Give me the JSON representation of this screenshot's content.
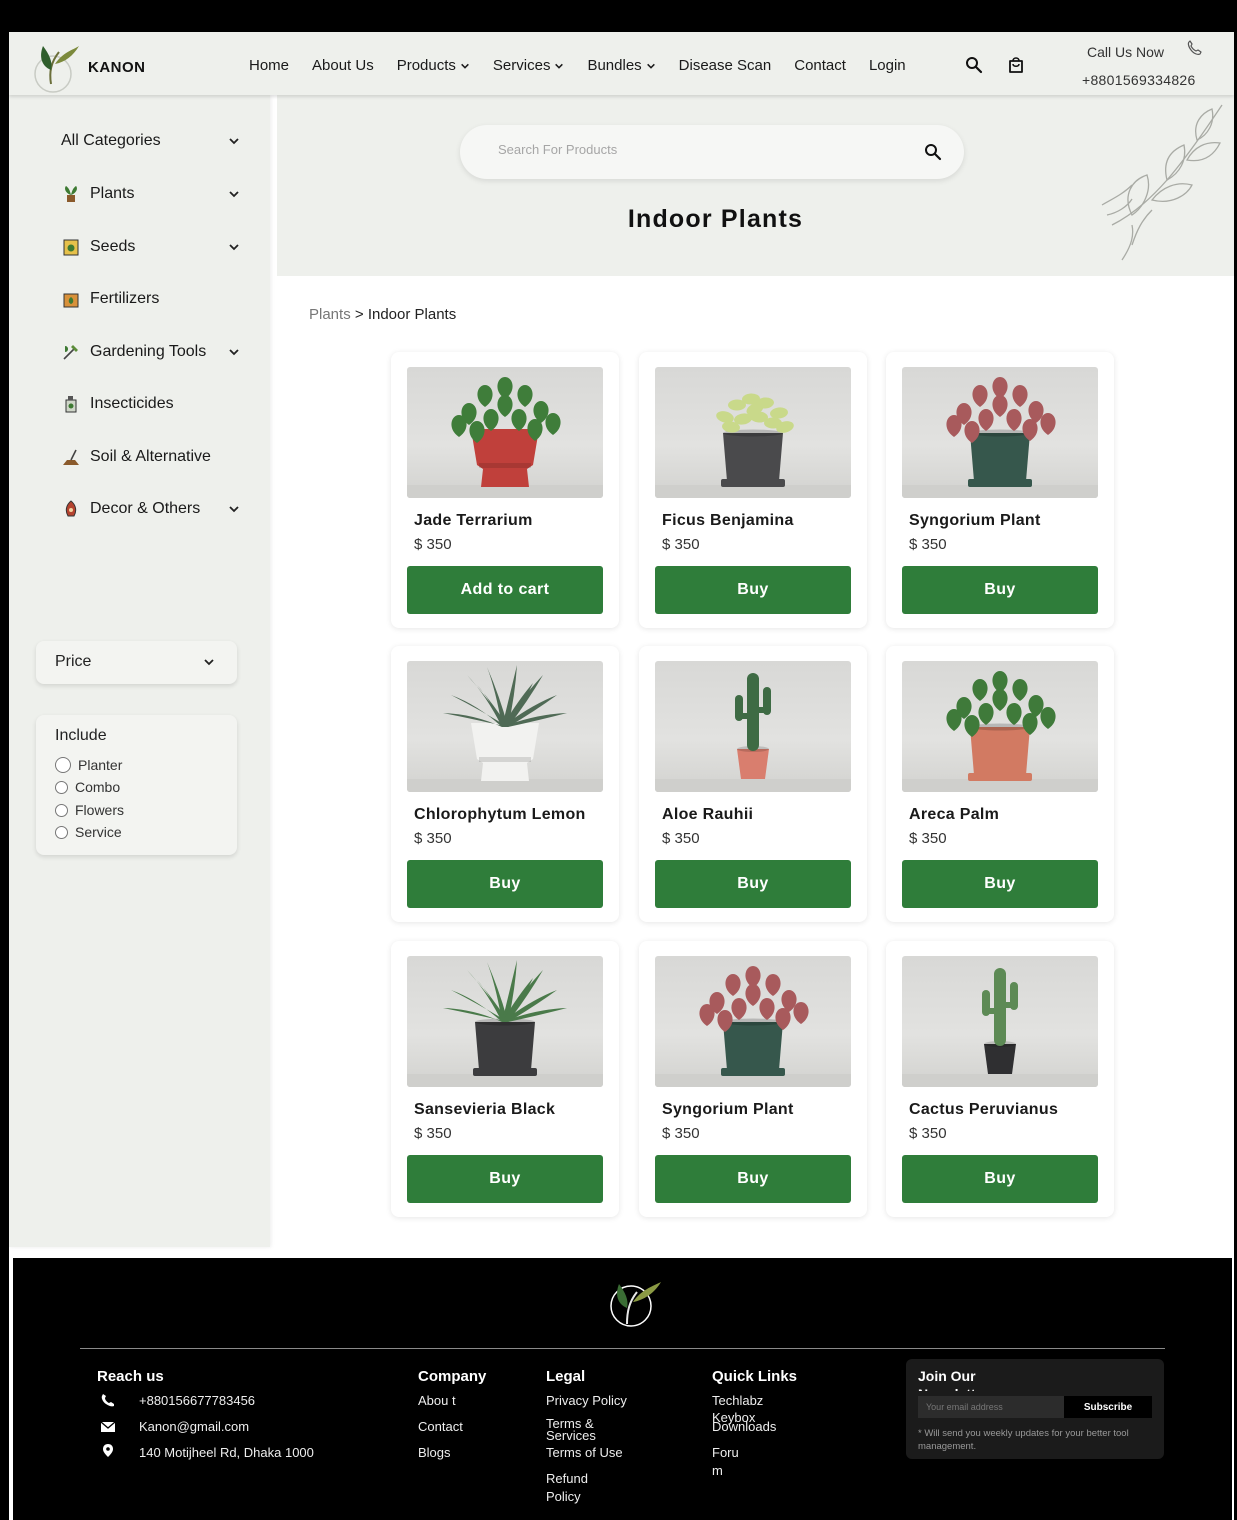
{
  "header": {
    "brand": "KANON",
    "nav": [
      {
        "label": "Home",
        "dropdown": false
      },
      {
        "label": "About Us",
        "dropdown": false
      },
      {
        "label": "Products",
        "dropdown": true
      },
      {
        "label": "Services",
        "dropdown": true
      },
      {
        "label": "Bundles",
        "dropdown": true
      },
      {
        "label": "Disease Scan",
        "dropdown": false
      },
      {
        "label": "Contact",
        "dropdown": false
      },
      {
        "label": "Login",
        "dropdown": false
      }
    ],
    "call_label": "Call Us Now",
    "phone": "+8801569334826"
  },
  "sidebar": {
    "categories": [
      {
        "label": "All Categories",
        "icon": "none",
        "dropdown": true
      },
      {
        "label": "Plants",
        "icon": "plant-icon",
        "dropdown": true
      },
      {
        "label": "Seeds",
        "icon": "seeds-icon",
        "dropdown": true
      },
      {
        "label": "Fertilizers",
        "icon": "fertilizer-icon",
        "dropdown": false
      },
      {
        "label": "Gardening Tools",
        "icon": "gardening-tools-icon",
        "dropdown": true
      },
      {
        "label": "Insecticides",
        "icon": "insecticide-icon",
        "dropdown": false
      },
      {
        "label": "Soil & Alternative",
        "icon": "soil-icon",
        "dropdown": false
      },
      {
        "label": "Decor & Others",
        "icon": "decor-icon",
        "dropdown": true
      }
    ],
    "price_label": "Price",
    "include_title": "Include",
    "include_options": [
      "Planter",
      "Combo",
      "Flowers",
      "Service"
    ]
  },
  "hero": {
    "search_placeholder": "Search For Products",
    "title": "Indoor Plants"
  },
  "breadcrumb": {
    "parent": "Plants",
    "separator": " > ",
    "current": "Indoor Plants"
  },
  "products": [
    {
      "name": "Jade Terrarium",
      "price": "$ 350",
      "button": "Add to cart",
      "pot": "#c0403b",
      "pot_shape": "stepped",
      "foliage": "#3f7d3a",
      "leaf_style": "broad"
    },
    {
      "name": "Ficus Benjamina",
      "price": "$ 350",
      "button": "Buy",
      "pot": "#4a4a4c",
      "pot_shape": "cylinder",
      "foliage": "#c9d98a",
      "leaf_style": "small"
    },
    {
      "name": "Syngorium Plant",
      "price": "$ 350",
      "button": "Buy",
      "pot": "#36574c",
      "pot_shape": "cylinder",
      "foliage": "#a85a5c",
      "leaf_style": "broad"
    },
    {
      "name": "Chlorophytum Lemon",
      "price": "$ 350",
      "button": "Buy",
      "pot": "#f2f2f0",
      "pot_shape": "stepped",
      "foliage": "#4f6a55",
      "leaf_style": "spiky"
    },
    {
      "name": "Aloe Rauhii",
      "price": "$ 350",
      "button": "Buy",
      "pot": "#d97e6e",
      "pot_shape": "small",
      "foliage": "#3e6b44",
      "leaf_style": "cactus"
    },
    {
      "name": "Areca Palm",
      "price": "$ 350",
      "button": "Buy",
      "pot": "#d27a62",
      "pot_shape": "cylinder",
      "foliage": "#3f7a3a",
      "leaf_style": "broad"
    },
    {
      "name": "Sansevieria Black",
      "price": "$ 350",
      "button": "Buy",
      "pot": "#3c3c3e",
      "pot_shape": "cylinder",
      "foliage": "#4a7a4a",
      "leaf_style": "spiky"
    },
    {
      "name": "Syngorium Plant",
      "price": "$ 350",
      "button": "Buy",
      "pot": "#36574c",
      "pot_shape": "cylinder",
      "foliage": "#a85a5c",
      "leaf_style": "broad"
    },
    {
      "name": "Cactus Peruvianus",
      "price": "$ 350",
      "button": "Buy",
      "pot": "#2f2f31",
      "pot_shape": "small",
      "foliage": "#5d8a55",
      "leaf_style": "cactus"
    }
  ],
  "footer": {
    "reach_title": "Reach us",
    "reach_phone": "+880156677783456",
    "reach_email": "Kanon@gmail.com",
    "reach_address": "140 Motijheel Rd, Dhaka 1000",
    "company_title": "Company",
    "company_links": [
      "Abou t",
      "Contact",
      "Blogs"
    ],
    "legal_title": "Legal",
    "legal_links": [
      "Privacy Policy",
      "Terms & Services",
      "Terms of Use",
      "Refund Policy"
    ],
    "quick_title": "Quick Links",
    "quick_links": [
      "Techlabz",
      "Keybox",
      "Downloads",
      "Foru m"
    ],
    "newsletter_title": "Join Our Newsletter",
    "newsletter_placeholder": "Your email address",
    "newsletter_button": "Subscribe",
    "newsletter_note": "* Will send you weekly updates for your better tool management."
  },
  "colors": {
    "accent": "#2f7d3a",
    "panel": "#eef0ec",
    "footer": "#000000"
  }
}
